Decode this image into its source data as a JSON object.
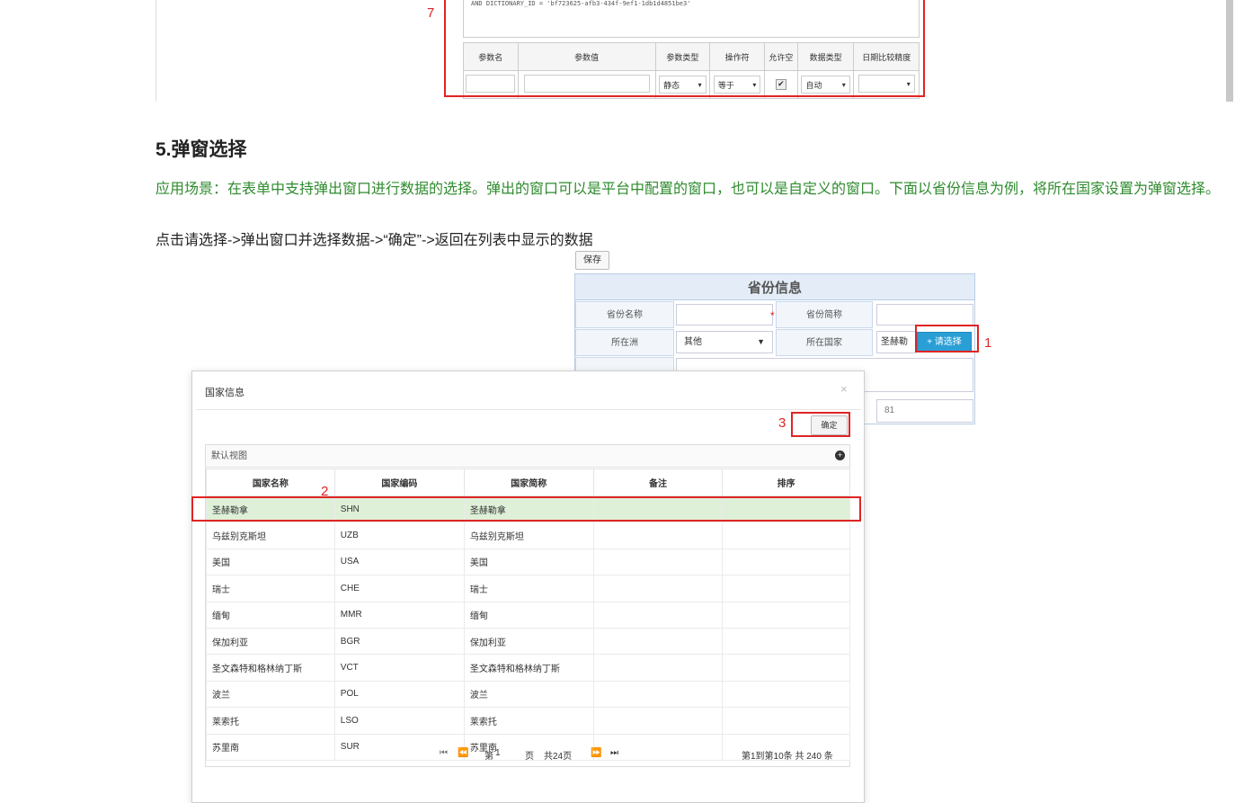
{
  "top": {
    "sql_text": "AND DICTIONARY_ID = 'bf723625-afb3-434f-9ef1-1db1d4851be3'",
    "params_headers": [
      "参数名",
      "参数值",
      "参数类型",
      "操作符",
      "允许空",
      "数据类型",
      "日期比较精度"
    ],
    "params_row": {
      "type": "静态",
      "operator": "等于",
      "allow_null": true,
      "data_type": "自动",
      "precision": ""
    },
    "marker": "7"
  },
  "section_title": "5.弹窗选择",
  "green_desc": "应用场景：在表单中支持弹出窗口进行数据的选择。弹出的窗口可以是平台中配置的窗口，也可以是自定义的窗口。下面以省份信息为例，将所在国家设置为弹窗选择。",
  "steps": "点击请选择->弹出窗口并选择数据->“确定”->返回在列表中显示的数据",
  "save_label": "保存",
  "province": {
    "title": "省份信息",
    "name_label": "省份名称",
    "short_label": "省份简称",
    "continent_label": "所在洲",
    "continent_value": "其他",
    "country_label": "所在国家",
    "country_value": "圣赫勒",
    "choose_label": "+ 请选择",
    "sort_value": "81",
    "required_mark": "*",
    "marker": "1"
  },
  "dialog": {
    "title": "国家信息",
    "close": "×",
    "ok_label": "确定",
    "ok_marker": "3",
    "row_marker": "2",
    "view_label": "默认视图",
    "plus": "+",
    "headers": [
      "国家名称",
      "国家编码",
      "国家简称",
      "备注",
      "排序"
    ],
    "rows": [
      [
        "圣赫勒拿",
        "SHN",
        "圣赫勒拿",
        "",
        ""
      ],
      [
        "乌兹别克斯坦",
        "UZB",
        "乌兹别克斯坦",
        "",
        ""
      ],
      [
        "美国",
        "USA",
        "美国",
        "",
        ""
      ],
      [
        "瑞士",
        "CHE",
        "瑞士",
        "",
        ""
      ],
      [
        "缅甸",
        "MMR",
        "缅甸",
        "",
        ""
      ],
      [
        "保加利亚",
        "BGR",
        "保加利亚",
        "",
        ""
      ],
      [
        "圣文森特和格林纳丁斯",
        "VCT",
        "圣文森特和格林纳丁斯",
        "",
        ""
      ],
      [
        "波兰",
        "POL",
        "波兰",
        "",
        ""
      ],
      [
        "莱索托",
        "LSO",
        "莱索托",
        "",
        ""
      ],
      [
        "苏里南",
        "SUR",
        "苏里南",
        "",
        ""
      ]
    ],
    "pager": {
      "page_prefix": "第",
      "page": "1",
      "page_suffix": "页",
      "total_pages": "共24页",
      "summary": "第1到第10条  共 240 条"
    }
  }
}
